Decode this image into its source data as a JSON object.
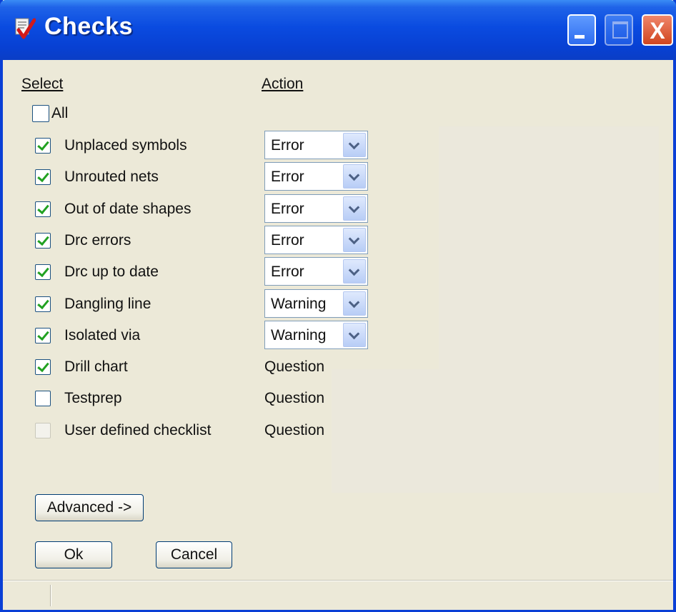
{
  "window": {
    "title": "Checks",
    "icon": "app-icon"
  },
  "titlebar_buttons": {
    "minimize": "minimize-icon",
    "maximize": "maximize-icon",
    "close_label": "X"
  },
  "headers": {
    "select": "Select",
    "action": "Action"
  },
  "select_all": {
    "label": "All",
    "checked": false
  },
  "checks": [
    {
      "label": "Unplaced symbols",
      "checked": true,
      "action": "Error",
      "editable": true
    },
    {
      "label": "Unrouted nets",
      "checked": true,
      "action": "Error",
      "editable": true
    },
    {
      "label": "Out of date shapes",
      "checked": true,
      "action": "Error",
      "editable": true
    },
    {
      "label": "Drc errors",
      "checked": true,
      "action": "Error",
      "editable": true
    },
    {
      "label": "Drc up to date",
      "checked": true,
      "action": "Error",
      "editable": true
    },
    {
      "label": "Dangling line",
      "checked": true,
      "action": "Warning",
      "editable": true
    },
    {
      "label": "Isolated via",
      "checked": true,
      "action": "Warning",
      "editable": true
    },
    {
      "label": "Drill chart",
      "checked": true,
      "action": "Question",
      "editable": false
    },
    {
      "label": "Testprep",
      "checked": false,
      "action": "Question",
      "editable": false
    },
    {
      "label": "User defined checklist",
      "checked": false,
      "disabled": true,
      "action": "Question",
      "editable": false
    }
  ],
  "buttons": {
    "advanced": "Advanced ->",
    "ok": "Ok",
    "cancel": "Cancel"
  },
  "colors": {
    "titlebar": "#0a4be0",
    "face": "#ece9d8",
    "checkmark": "#21a121",
    "close": "#d0451f"
  }
}
